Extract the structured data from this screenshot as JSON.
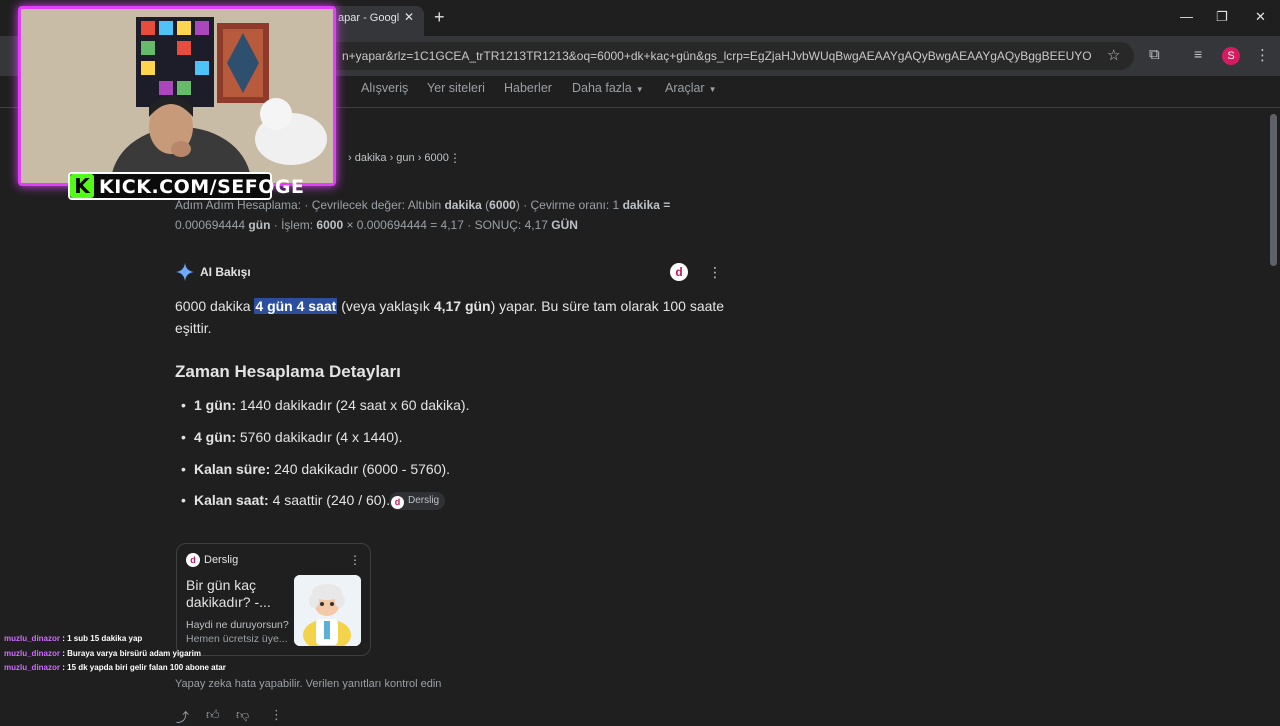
{
  "browser": {
    "tab_title": "apar - Googl",
    "url": "n+yapar&rlz=1C1GCEA_trTR1213TR1213&oq=6000+dk+kaç+gün&gs_lcrp=EgZjaHJvbWUqBwgAEAAYgAQyBwgAEAAYgAQyBggBEEUYOTIHCAI...",
    "profile_initial": "S"
  },
  "search_nav": {
    "tabs": [
      {
        "label": "Alışveriş"
      },
      {
        "label": "Yer siteleri"
      },
      {
        "label": "Haberler"
      },
      {
        "label": "Daha fazla"
      },
      {
        "label": "Araçlar"
      }
    ]
  },
  "result": {
    "breadcrumb": "› dakika › gun › 6000",
    "snippet_1a": "Adım Adım Hesaplama: · Çevrilecek değer: Altıbin ",
    "snippet_1b": "dakika",
    "snippet_1c": " (",
    "snippet_1d": "6000",
    "snippet_1e": ") · Çevirme oranı: 1 ",
    "snippet_1f": "dakika =",
    "snippet_2a": "0.000694444 ",
    "snippet_2b": "gün",
    "snippet_2c": " · İşlem: ",
    "snippet_2d": "6000",
    "snippet_2e": " × 0.000694444 = 4,17 · SONUÇ: 4,17 ",
    "snippet_2f": "GÜN"
  },
  "ai_overview": {
    "title": "AI Bakışı",
    "answer_a": "6000 dakika ",
    "answer_highlight": "4 gün 4 saat",
    "answer_b": " (veya yaklaşık ",
    "answer_bold": "4,17 gün",
    "answer_c": ") yapar. Bu süre tam olarak 100 saate",
    "answer_line2": "eşittir.",
    "heading": "Zaman Hesaplama Detayları",
    "items": [
      {
        "term": "1 gün:",
        "text": " 1440 dakikadır (24 saat x 60 dakika)."
      },
      {
        "term": "4 gün:",
        "text": " 5760 dakikadır (4 x 1440)."
      },
      {
        "term": "Kalan süre:",
        "text": " 240 dakikadır (6000 - 5760)."
      },
      {
        "term": "Kalan saat:",
        "text": " 4 saattir (240 / 60)."
      }
    ],
    "source_chip": "Derslig",
    "card": {
      "site": "Derslig",
      "title_1": "Bir gün kaç",
      "title_2": "dakikadır? -...",
      "desc_1": "Haydi ne duruyorsun?",
      "desc_2": "Hemen ücretsiz üye..."
    },
    "disclaimer": "Yapay zeka hata yapabilir. Verilen yanıtları kontrol edin"
  },
  "stream": {
    "kick_channel": "KICK.COM/SEFOGE",
    "chat": [
      {
        "user": "muzlu_dinazor",
        "message": " : 1 sub 15 dakika yap"
      },
      {
        "user": "muzlu_dinazor",
        "message": " : Buraya varya birsürü adam yigarim"
      },
      {
        "user": "muzlu_dinazor",
        "message": " : 15 dk yapda biri gelir falan 100 abone atar"
      }
    ]
  },
  "colors": {
    "highlight": "#2b4f9d",
    "kick_green": "#53fc18",
    "frame_pink": "#e040fb"
  }
}
